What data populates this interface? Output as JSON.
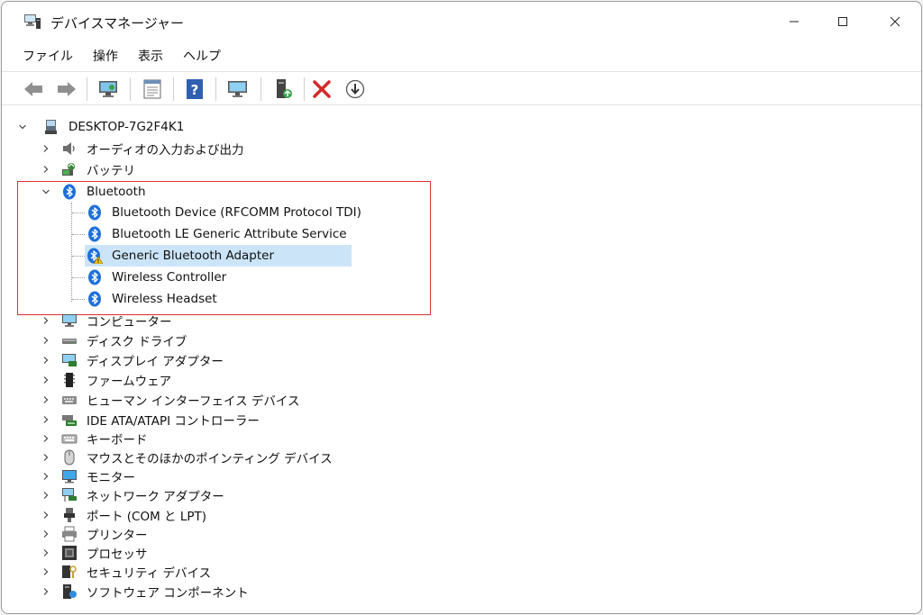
{
  "window": {
    "title": "デバイスマネージャー"
  },
  "menu": {
    "items": [
      "ファイル",
      "操作",
      "表示",
      "ヘルプ"
    ]
  },
  "toolbar": {
    "icons": [
      "back-arrow-icon",
      "forward-arrow-icon",
      "scan-hardware-icon",
      "properties-icon",
      "help-icon",
      "monitor-icon",
      "update-driver-icon",
      "uninstall-x-icon",
      "disable-device-icon"
    ]
  },
  "tree": {
    "root": "DESKTOP-7G2F4K1",
    "categories": [
      {
        "label": "オーディオの入力および出力",
        "icon": "speaker-icon"
      },
      {
        "label": "バッテリ",
        "icon": "battery-icon"
      },
      {
        "label": "Bluetooth",
        "icon": "bluetooth-icon",
        "expanded": true,
        "children": [
          {
            "label": "Bluetooth Device (RFCOMM Protocol TDI)",
            "icon": "bluetooth-icon"
          },
          {
            "label": "Bluetooth LE Generic Attribute Service",
            "icon": "bluetooth-icon"
          },
          {
            "label": "Generic Bluetooth Adapter",
            "icon": "bluetooth-warning-icon",
            "selected": true
          },
          {
            "label": "Wireless Controller",
            "icon": "bluetooth-icon"
          },
          {
            "label": "Wireless Headset",
            "icon": "bluetooth-icon"
          }
        ]
      },
      {
        "label": "コンピューター",
        "icon": "computer-icon"
      },
      {
        "label": "ディスク ドライブ",
        "icon": "disk-drive-icon"
      },
      {
        "label": "ディスプレイ アダプター",
        "icon": "display-adapter-icon"
      },
      {
        "label": "ファームウェア",
        "icon": "firmware-icon"
      },
      {
        "label": "ヒューマン インターフェイス デバイス",
        "icon": "hid-icon"
      },
      {
        "label": "IDE ATA/ATAPI コントローラー",
        "icon": "ide-controller-icon"
      },
      {
        "label": "キーボード",
        "icon": "keyboard-icon"
      },
      {
        "label": "マウスとそのほかのポインティング デバイス",
        "icon": "mouse-icon"
      },
      {
        "label": "モニター",
        "icon": "monitor-icon"
      },
      {
        "label": "ネットワーク アダプター",
        "icon": "network-adapter-icon"
      },
      {
        "label": "ポート (COM と LPT)",
        "icon": "port-icon"
      },
      {
        "label": "プリンター",
        "icon": "printer-icon"
      },
      {
        "label": "プロセッサ",
        "icon": "processor-icon"
      },
      {
        "label": "セキュリティ デバイス",
        "icon": "security-device-icon"
      },
      {
        "label": "ソフトウェア コンポーネント",
        "icon": "software-component-icon"
      }
    ]
  },
  "colors": {
    "selection": "#cce4f7",
    "highlight_box": "#e03030",
    "bluetooth": "#1e6fd9"
  }
}
